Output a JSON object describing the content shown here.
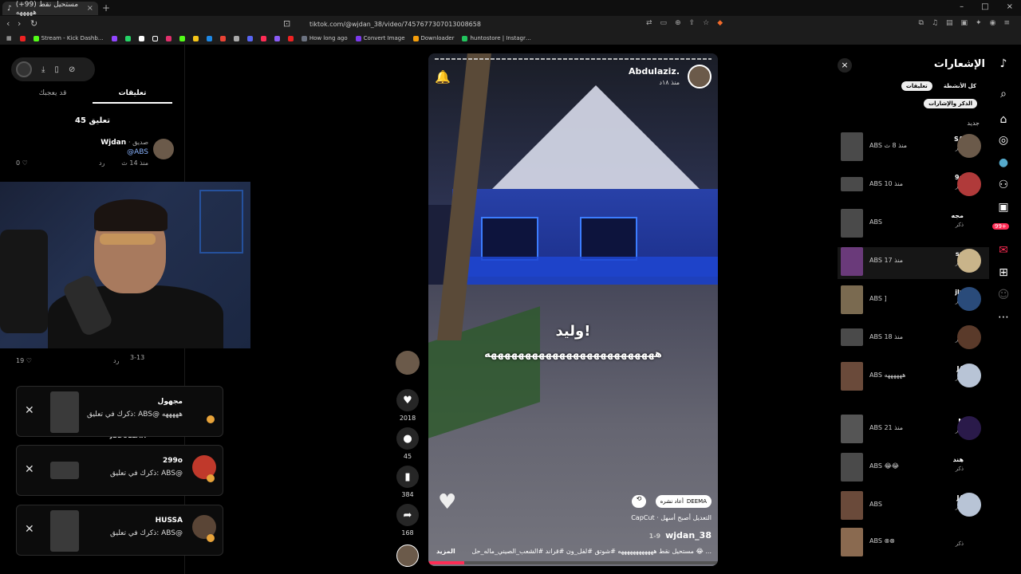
{
  "browser": {
    "tab_title": "(+99) مستحيل نقط هههههه",
    "url": "tiktok.com/@wjdan_38/video/7457677307013008658",
    "bookmarks": [
      "Stream - Kick Dashb…",
      "How long ago",
      "Convert Image",
      "Downloader",
      "huntostore | Instagr…"
    ]
  },
  "left_panel": {
    "tabs": [
      "تعليقات",
      "قد يعجبك"
    ],
    "comment_count": "45 تعليق",
    "comments": [
      {
        "name": "Wjdan",
        "badge": "· صديق",
        "text": "@ABS",
        "time": "منذ 14 ث",
        "reply": "رد",
        "likes": "0"
      }
    ],
    "below_cam": {
      "line1": "3-13",
      "reply": "رد",
      "likes": "19"
    },
    "overlay_name": "JBDULLAH"
  },
  "toasts": [
    {
      "title": "مجهول",
      "text": "ذكرك في تعليق: ABS@ هههههه"
    },
    {
      "title": "299o",
      "text": "ذكرك في تعليق: ABS@"
    },
    {
      "title": "HUSSA",
      "text": "ذكرك في تعليق: ABS@"
    }
  ],
  "video": {
    "author": "Abdulaziz.",
    "time": "منذ ١٨د",
    "caption_line1": "وليد!",
    "caption_line2": "هههههههههههههههههههههههههه",
    "repost_user": "DEEMA",
    "repost_label": "أعاد نشره",
    "capcut": "CapCut · التعديل أصبح أسهل",
    "handle": "wjdan_38",
    "date": "1-9",
    "description": "مستحيل نقط ههههههههههههه #شوتق #لفل_ون #قراند #الشعب_الصيني_ماله_حل 😂 ...",
    "more": "المزيد"
  },
  "actions": {
    "likes": "2018",
    "comments": "45",
    "saves": "384",
    "shares": "168"
  },
  "notifications": {
    "title": "الإشعارات",
    "tabs": [
      "كل الأنشطة",
      "تعليقات"
    ],
    "sub_tab": "الذكر والإشارات",
    "section": "جديد",
    "rows": [
      {
        "name": "SA",
        "sub": "ذكر",
        "meta": "ABS منذ 8 ث"
      },
      {
        "name": "9o",
        "sub": "ذكر",
        "meta": "ABS منذ 10"
      },
      {
        "name": "مجه",
        "sub": "ذكر",
        "meta": "ABS"
      },
      {
        "name": "sa",
        "sub": "ذكر",
        "meta": "ABS منذ 17"
      },
      {
        "name": "jly",
        "sub": "ذكر",
        "meta": "ABS ]"
      },
      {
        "name": "",
        "sub": "ذكر",
        "meta": "ABS منذ 18"
      },
      {
        "name": "J4",
        "sub": "ذكر",
        "meta": "ABS ههههههه"
      },
      {
        "name": "N",
        "sub": "ذكر",
        "meta": "ABS منذ 21"
      },
      {
        "name": "هند",
        "sub": "ذكر",
        "meta": "ABS 😂😂"
      },
      {
        "name": "J4",
        "sub": "ذكر",
        "meta": "ABS"
      },
      {
        "name": "",
        "sub": "ذكر",
        "meta": "ABS ⊗⊗"
      }
    ]
  },
  "side_badge": "99+"
}
